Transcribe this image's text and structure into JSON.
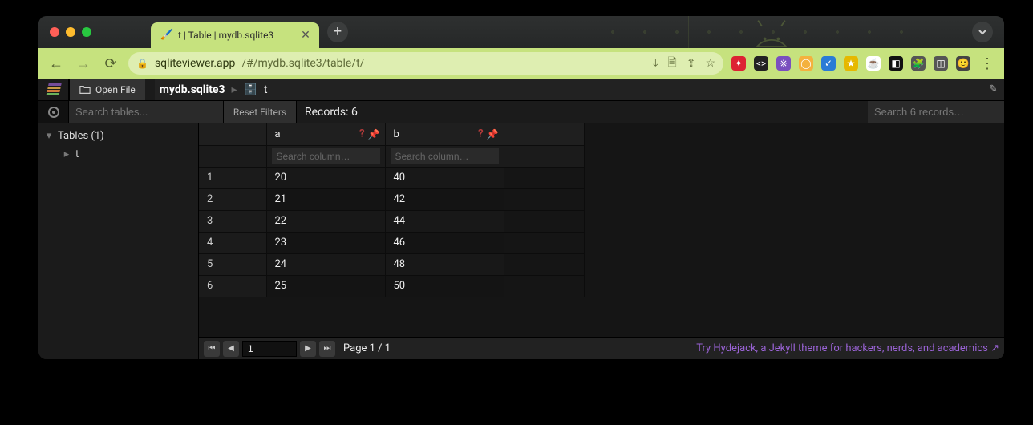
{
  "browser": {
    "tab_title": "t | Table | mydb.sqlite3",
    "url_host": "sqliteviewer.app",
    "url_path": "/#/mydb.sqlite3/table/t/"
  },
  "topbar": {
    "open_file_label": "Open File",
    "breadcrumb_db": "mydb.sqlite3",
    "breadcrumb_table": "t"
  },
  "toolbar": {
    "search_tables_placeholder": "Search tables...",
    "reset_filters_label": "Reset Filters",
    "records_label": "Records: 6",
    "search_records_placeholder": "Search 6 records…"
  },
  "sidebar": {
    "group_label": "Tables (1)",
    "items": [
      {
        "label": "t"
      }
    ]
  },
  "grid": {
    "columns": [
      {
        "name": "a",
        "filter_placeholder": "Search column…"
      },
      {
        "name": "b",
        "filter_placeholder": "Search column…"
      }
    ],
    "rows": [
      {
        "n": "1",
        "a": "20",
        "b": "40"
      },
      {
        "n": "2",
        "a": "21",
        "b": "42"
      },
      {
        "n": "3",
        "a": "22",
        "b": "44"
      },
      {
        "n": "4",
        "a": "23",
        "b": "46"
      },
      {
        "n": "5",
        "a": "24",
        "b": "48"
      },
      {
        "n": "6",
        "a": "25",
        "b": "50"
      }
    ]
  },
  "footer": {
    "page_input_value": "1",
    "page_label": "Page 1 / 1",
    "promo_text": "Try Hydejack, a Jekyll theme for hackers, nerds, and academics ↗"
  },
  "chart_data": {
    "type": "table",
    "columns": [
      "a",
      "b"
    ],
    "rows": [
      [
        20,
        40
      ],
      [
        21,
        42
      ],
      [
        22,
        44
      ],
      [
        23,
        46
      ],
      [
        24,
        48
      ],
      [
        25,
        50
      ]
    ]
  }
}
